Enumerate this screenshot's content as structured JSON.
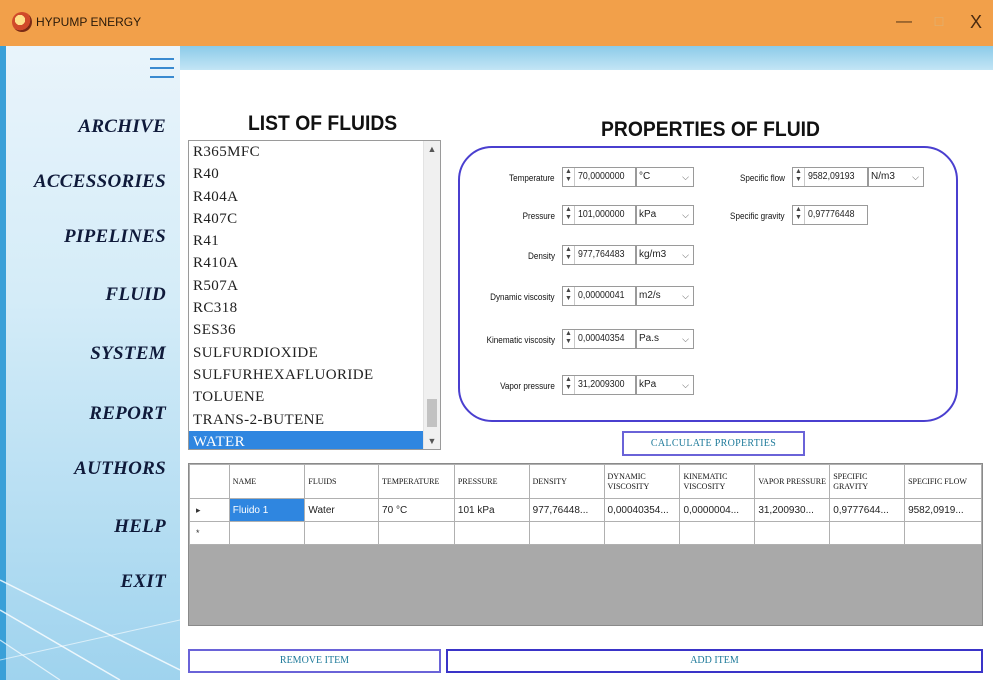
{
  "window": {
    "title": "HYPUMP ENERGY",
    "controls": {
      "minimize": "—",
      "maximize": "☐",
      "close": "X"
    }
  },
  "sidebar": {
    "items": [
      {
        "label": "ARCHIVE"
      },
      {
        "label": "ACCESSORIES"
      },
      {
        "label": "PIPELINES"
      },
      {
        "label": "FLUID"
      },
      {
        "label": "SYSTEM"
      },
      {
        "label": "REPORT"
      },
      {
        "label": "AUTHORS"
      },
      {
        "label": "HELP"
      },
      {
        "label": "EXIT"
      }
    ]
  },
  "fluids": {
    "title": "LIST OF FLUIDS",
    "items": [
      "R365MFC",
      "R40",
      "R404A",
      "R407C",
      "R41",
      "R410A",
      "R507A",
      "RC318",
      "SES36",
      "SULFURDIOXIDE",
      "SULFURHEXAFLUORIDE",
      "TOLUENE",
      "TRANS-2-BUTENE",
      "WATER"
    ],
    "selected": "WATER"
  },
  "properties": {
    "title": "PROPERTIES OF FLUID",
    "temperature": {
      "label": "Temperature",
      "value": "70,0000000",
      "unit": "°C"
    },
    "pressure": {
      "label": "Pressure",
      "value": "101,000000",
      "unit": "kPa"
    },
    "density": {
      "label": "Density",
      "value": "977,764483",
      "unit": "kg/m3"
    },
    "dynamic_viscosity": {
      "label": "Dynamic viscosity",
      "value": "0,00000041",
      "unit": "m2/s"
    },
    "kinematic_viscosity": {
      "label": "Kinematic viscosity",
      "value": "0,00040354",
      "unit": "Pa.s"
    },
    "vapor_pressure": {
      "label": "Vapor pressure",
      "value": "31,2009300",
      "unit": "kPa"
    },
    "specific_flow": {
      "label": "Specific flow",
      "value": "9582,09193",
      "unit": "N/m3"
    },
    "specific_gravity": {
      "label": "Specific gravity",
      "value": "0,97776448"
    },
    "calculate_label": "CALCULATE PROPERTIES"
  },
  "table": {
    "headers": [
      "NAME",
      "FLUIDS",
      "TEMPERATURE",
      "PRESSURE",
      "DENSITY",
      "DYNAMIC VISCOSITY",
      "KINEMATIC VISCOSITY",
      "VAPOR PRESSURE",
      "SPECIFIC GRAVITY",
      "SPECIFIC FLOW"
    ],
    "rows": [
      {
        "marker": "▸",
        "cells": [
          "Fluido 1",
          "Water",
          "70 °C",
          "101 kPa",
          "977,76448...",
          "0,00040354...",
          "0,0000004...",
          "31,200930...",
          "0,9777644...",
          "9582,0919..."
        ]
      }
    ],
    "new_row_marker": "*"
  },
  "actions": {
    "remove_label": "REMOVE ITEM",
    "add_label": "ADD ITEM"
  },
  "colors": {
    "titlebar": "#f2a04a",
    "selection": "#2f86e0",
    "frame_accent": "#4a3fcf",
    "button_text": "#1e7a9a"
  }
}
